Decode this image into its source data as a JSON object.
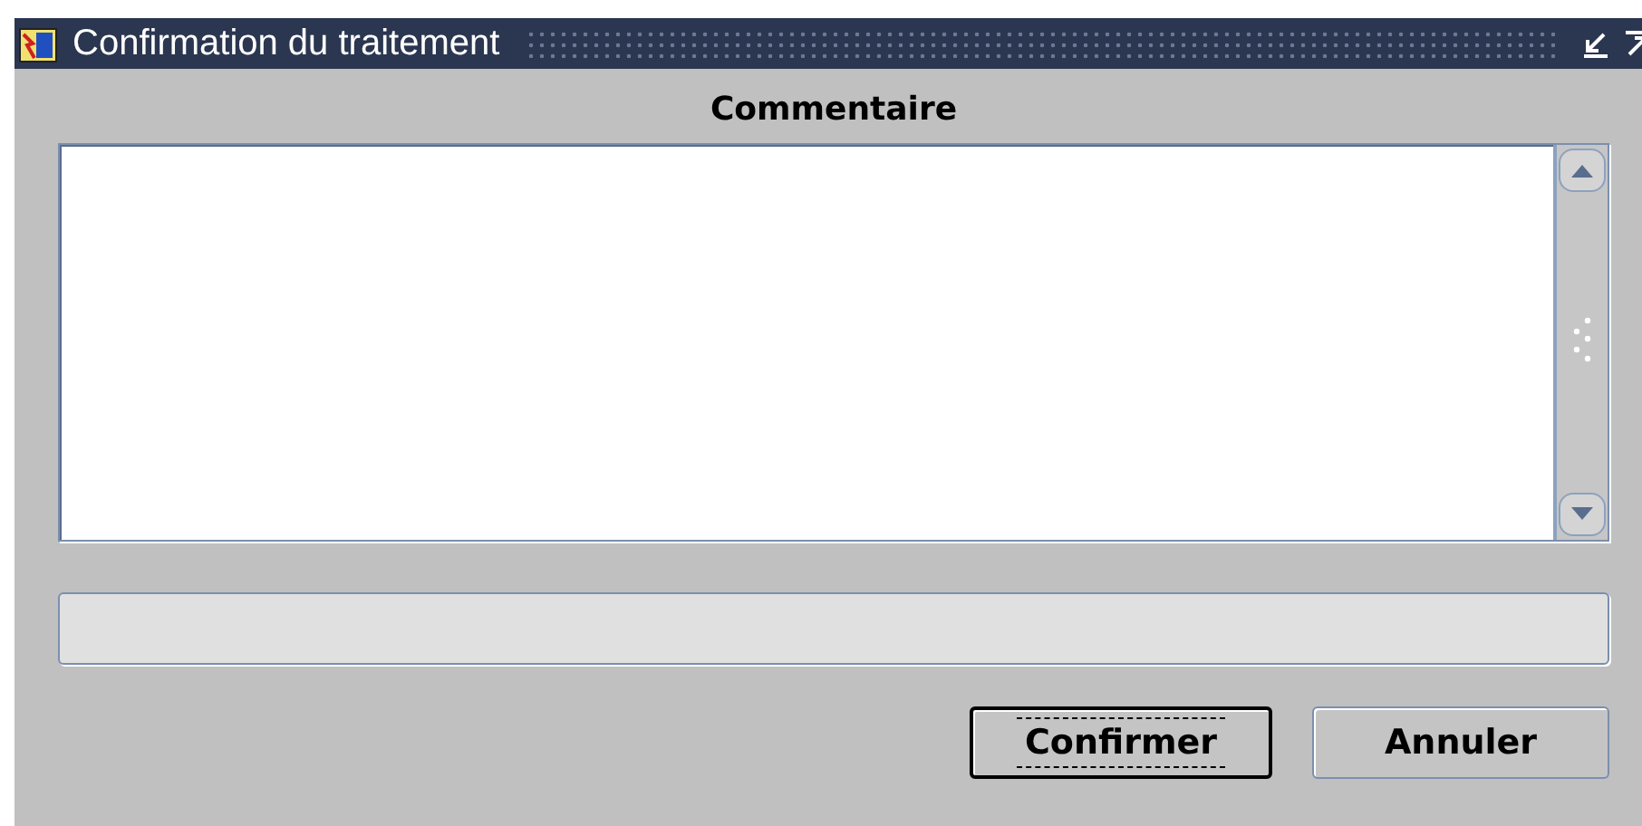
{
  "window": {
    "title": "Confirmation du traitement"
  },
  "comment": {
    "label": "Commentaire"
  },
  "buttons": [
    {
      "label": "Confirmer",
      "focused": true
    },
    {
      "label": "Annuler",
      "focused": false
    }
  ]
}
